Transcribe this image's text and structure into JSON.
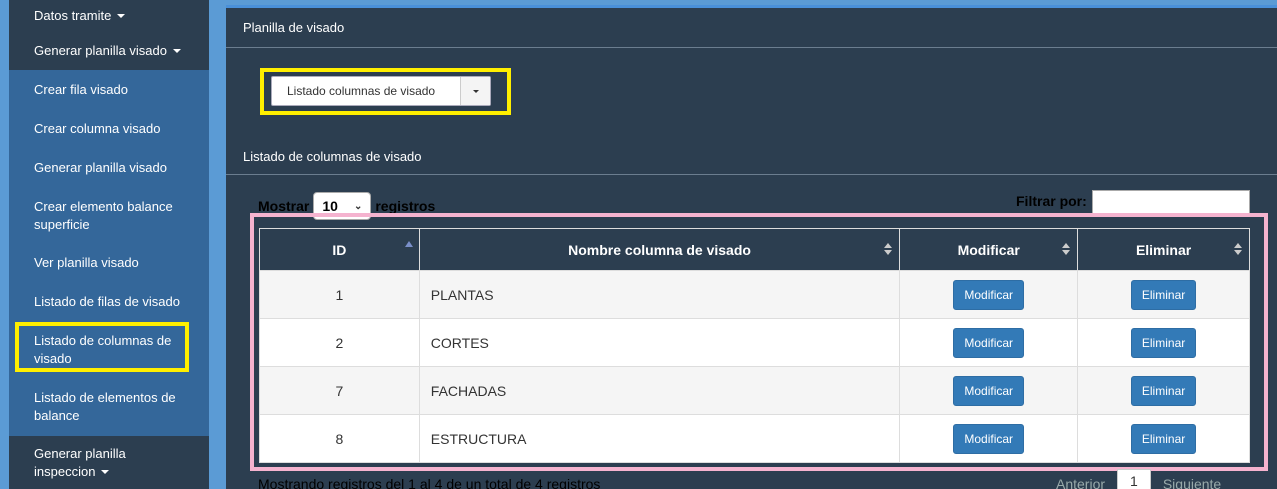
{
  "sidebar": {
    "items": [
      {
        "label": "Datos tramite",
        "caret": true
      },
      {
        "label": "Generar planilla visado",
        "caret": true
      },
      {
        "label": "Crear fila visado"
      },
      {
        "label": "Crear columna visado"
      },
      {
        "label": "Generar planilla visado"
      },
      {
        "label": "Crear elemento balance superficie"
      },
      {
        "label": "Ver planilla visado"
      },
      {
        "label": "Listado de filas de visado"
      },
      {
        "label": "Listado de columnas de visado"
      },
      {
        "label": "Listado de elementos de balance"
      },
      {
        "label": "Generar planilla inspeccion",
        "caret": true
      }
    ]
  },
  "panel": {
    "title": "Planilla de visado",
    "dropdown_value": "Listado columnas de visado",
    "section_title": "Listado de columnas de visado"
  },
  "table_controls": {
    "show_label": "Mostrar",
    "show_value": "10",
    "records_label": "registros",
    "filter_label": "Filtrar por:"
  },
  "table": {
    "headers": [
      "ID",
      "Nombre columna de visado",
      "Modificar",
      "Eliminar"
    ],
    "rows": [
      {
        "id": "1",
        "name": "PLANTAS",
        "modify": "Modificar",
        "delete": "Eliminar"
      },
      {
        "id": "2",
        "name": "CORTES",
        "modify": "Modificar",
        "delete": "Eliminar"
      },
      {
        "id": "7",
        "name": "FACHADAS",
        "modify": "Modificar",
        "delete": "Eliminar"
      },
      {
        "id": "8",
        "name": "ESTRUCTURA",
        "modify": "Modificar",
        "delete": "Eliminar"
      }
    ]
  },
  "footer": {
    "info": "Mostrando registros del 1 al 4 de un total de 4 registros",
    "prev": "Anterior",
    "page": "1",
    "next": "Siguiente"
  },
  "colors": {
    "highlight_yellow": "#ffef00",
    "highlight_pink": "#f5b3cf",
    "button_blue": "#337ab7",
    "panel_dark": "#2c3e50"
  }
}
